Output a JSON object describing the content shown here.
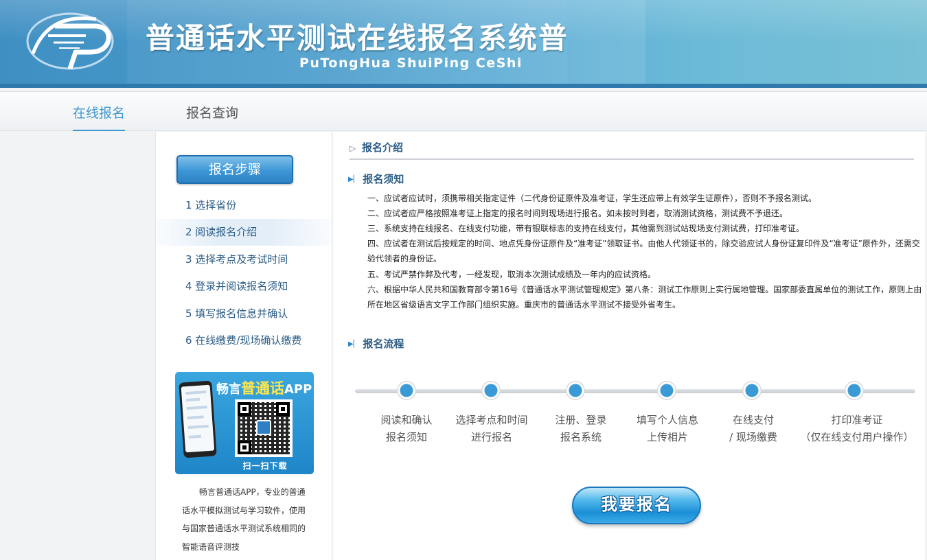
{
  "header": {
    "title": "普通话水平测试在线报名系统普通",
    "subtitle": "PuTongHua ShuiPing CeShi"
  },
  "nav": {
    "items": [
      {
        "label": "在线报名",
        "active": true
      },
      {
        "label": "报名查询",
        "active": false
      }
    ],
    "accent_color": "#3f98cf"
  },
  "sidebar": {
    "steps_title": "报名步骤",
    "steps": [
      {
        "label": "1 选择省份"
      },
      {
        "label": "2 阅读报名介绍",
        "active": true
      },
      {
        "label": "3 选择考点及考试时间"
      },
      {
        "label": "4 登录并阅读报名须知"
      },
      {
        "label": "5 填写报名信息并确认"
      },
      {
        "label": "6 在线缴费/现场确认缴费"
      }
    ],
    "app_promo": {
      "title_prefix": "畅言",
      "title_highlight": "普通话",
      "title_suffix": "APP",
      "scan_label": "扫一扫下载",
      "description": "畅言普通话APP，专业的普通话水平模拟测试与学习软件，使用与国家普通话水平测试系统相同的智能语音评测技"
    }
  },
  "main": {
    "section_title": "报名介绍",
    "notice": {
      "title": "报名须知",
      "lines": [
        "一、应试者应试时，须携带相关指定证件（二代身份证原件及准考证，学生还应带上有效学生证原件），否则不予报名测试。",
        "二、应试者应严格按照准考证上指定的报名时间到现场进行报名。如未按时到者，取消测试资格，测试费不予退还。",
        "三、系统支持在线报名、在线支付功能，带有银联标志的支持在线支付，其他需到测试站现场支付测试费，打印准考证。",
        "四、应试者在测试后按规定的时间、地点凭身份证原件及“准考证”领取证书。由他人代领证书的，除交验应试人身份证复印件及“准考证”原件外，还需交验代领者的身份证。",
        "五、考试严禁作弊及代考，一经发现，取消本次测试成绩及一年内的应试资格。",
        "六、根据中华人民共和国教育部令第16号《普通话水平测试管理规定》第八条：测试工作原则上实行属地管理。国家部委直属单位的测试工作，原则上由所在地区省级语言文字工作部门组织实施。重庆市的普通话水平测试不接受外省考生。"
      ]
    },
    "flow": {
      "title": "报名流程",
      "steps": [
        {
          "line1": "阅读和确认",
          "line2": "报名须知"
        },
        {
          "line1": "选择考点和时间",
          "line2": "进行报名"
        },
        {
          "line1": "注册、登录",
          "line2": "报名系统"
        },
        {
          "line1": "填写个人信息",
          "line2": "上传相片"
        },
        {
          "line1": "在线支付",
          "line2": "/ 现场缴费"
        },
        {
          "line1": "打印准考证",
          "line2": "（仅在线支付用户操作）"
        }
      ]
    },
    "register_button": "我要报名"
  }
}
